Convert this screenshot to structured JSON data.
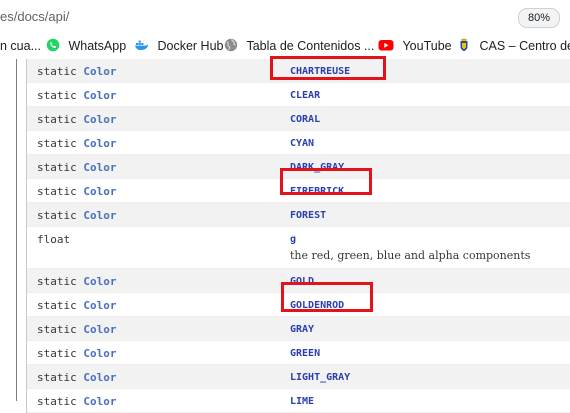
{
  "browser": {
    "url_text": "es/docs/api/",
    "zoom": "80%"
  },
  "bookmarks": [
    {
      "label": "n cua...",
      "icon": "bookmark-icon"
    },
    {
      "label": "WhatsApp",
      "icon": "whatsapp-icon"
    },
    {
      "label": "Docker Hub",
      "icon": "docker-icon"
    },
    {
      "label": "Tabla de Contenidos ...",
      "icon": "globe-icon"
    },
    {
      "label": "YouTube",
      "icon": "youtube-icon"
    },
    {
      "label": "CAS – Centro de A",
      "icon": "cas-crest-icon"
    }
  ],
  "fields": [
    {
      "modifier": "static",
      "type": "Color",
      "name": "CHARTREUSE",
      "highlighted": true
    },
    {
      "modifier": "static",
      "type": "Color",
      "name": "CLEAR",
      "highlighted": false
    },
    {
      "modifier": "static",
      "type": "Color",
      "name": "CORAL",
      "highlighted": false
    },
    {
      "modifier": "static",
      "type": "Color",
      "name": "CYAN",
      "highlighted": false
    },
    {
      "modifier": "static",
      "type": "Color",
      "name": "DARK_GRAY",
      "highlighted": false
    },
    {
      "modifier": "static",
      "type": "Color",
      "name": "FIREBRICK",
      "highlighted": true
    },
    {
      "modifier": "static",
      "type": "Color",
      "name": "FOREST",
      "highlighted": false
    },
    {
      "modifier": "float",
      "type": "",
      "name": "g",
      "description": "the red, green, blue and alpha components",
      "highlighted": false
    },
    {
      "modifier": "static",
      "type": "Color",
      "name": "GOLD",
      "highlighted": false
    },
    {
      "modifier": "static",
      "type": "Color",
      "name": "GOLDENROD",
      "highlighted": true
    },
    {
      "modifier": "static",
      "type": "Color",
      "name": "GRAY",
      "highlighted": false
    },
    {
      "modifier": "static",
      "type": "Color",
      "name": "GREEN",
      "highlighted": false
    },
    {
      "modifier": "static",
      "type": "Color",
      "name": "LIGHT_GRAY",
      "highlighted": false
    },
    {
      "modifier": "static",
      "type": "Color",
      "name": "LIME",
      "highlighted": false
    }
  ],
  "colors": {
    "highlight": "#e3131b",
    "link": "#2a3fb0",
    "type": "#4a6fbf"
  }
}
